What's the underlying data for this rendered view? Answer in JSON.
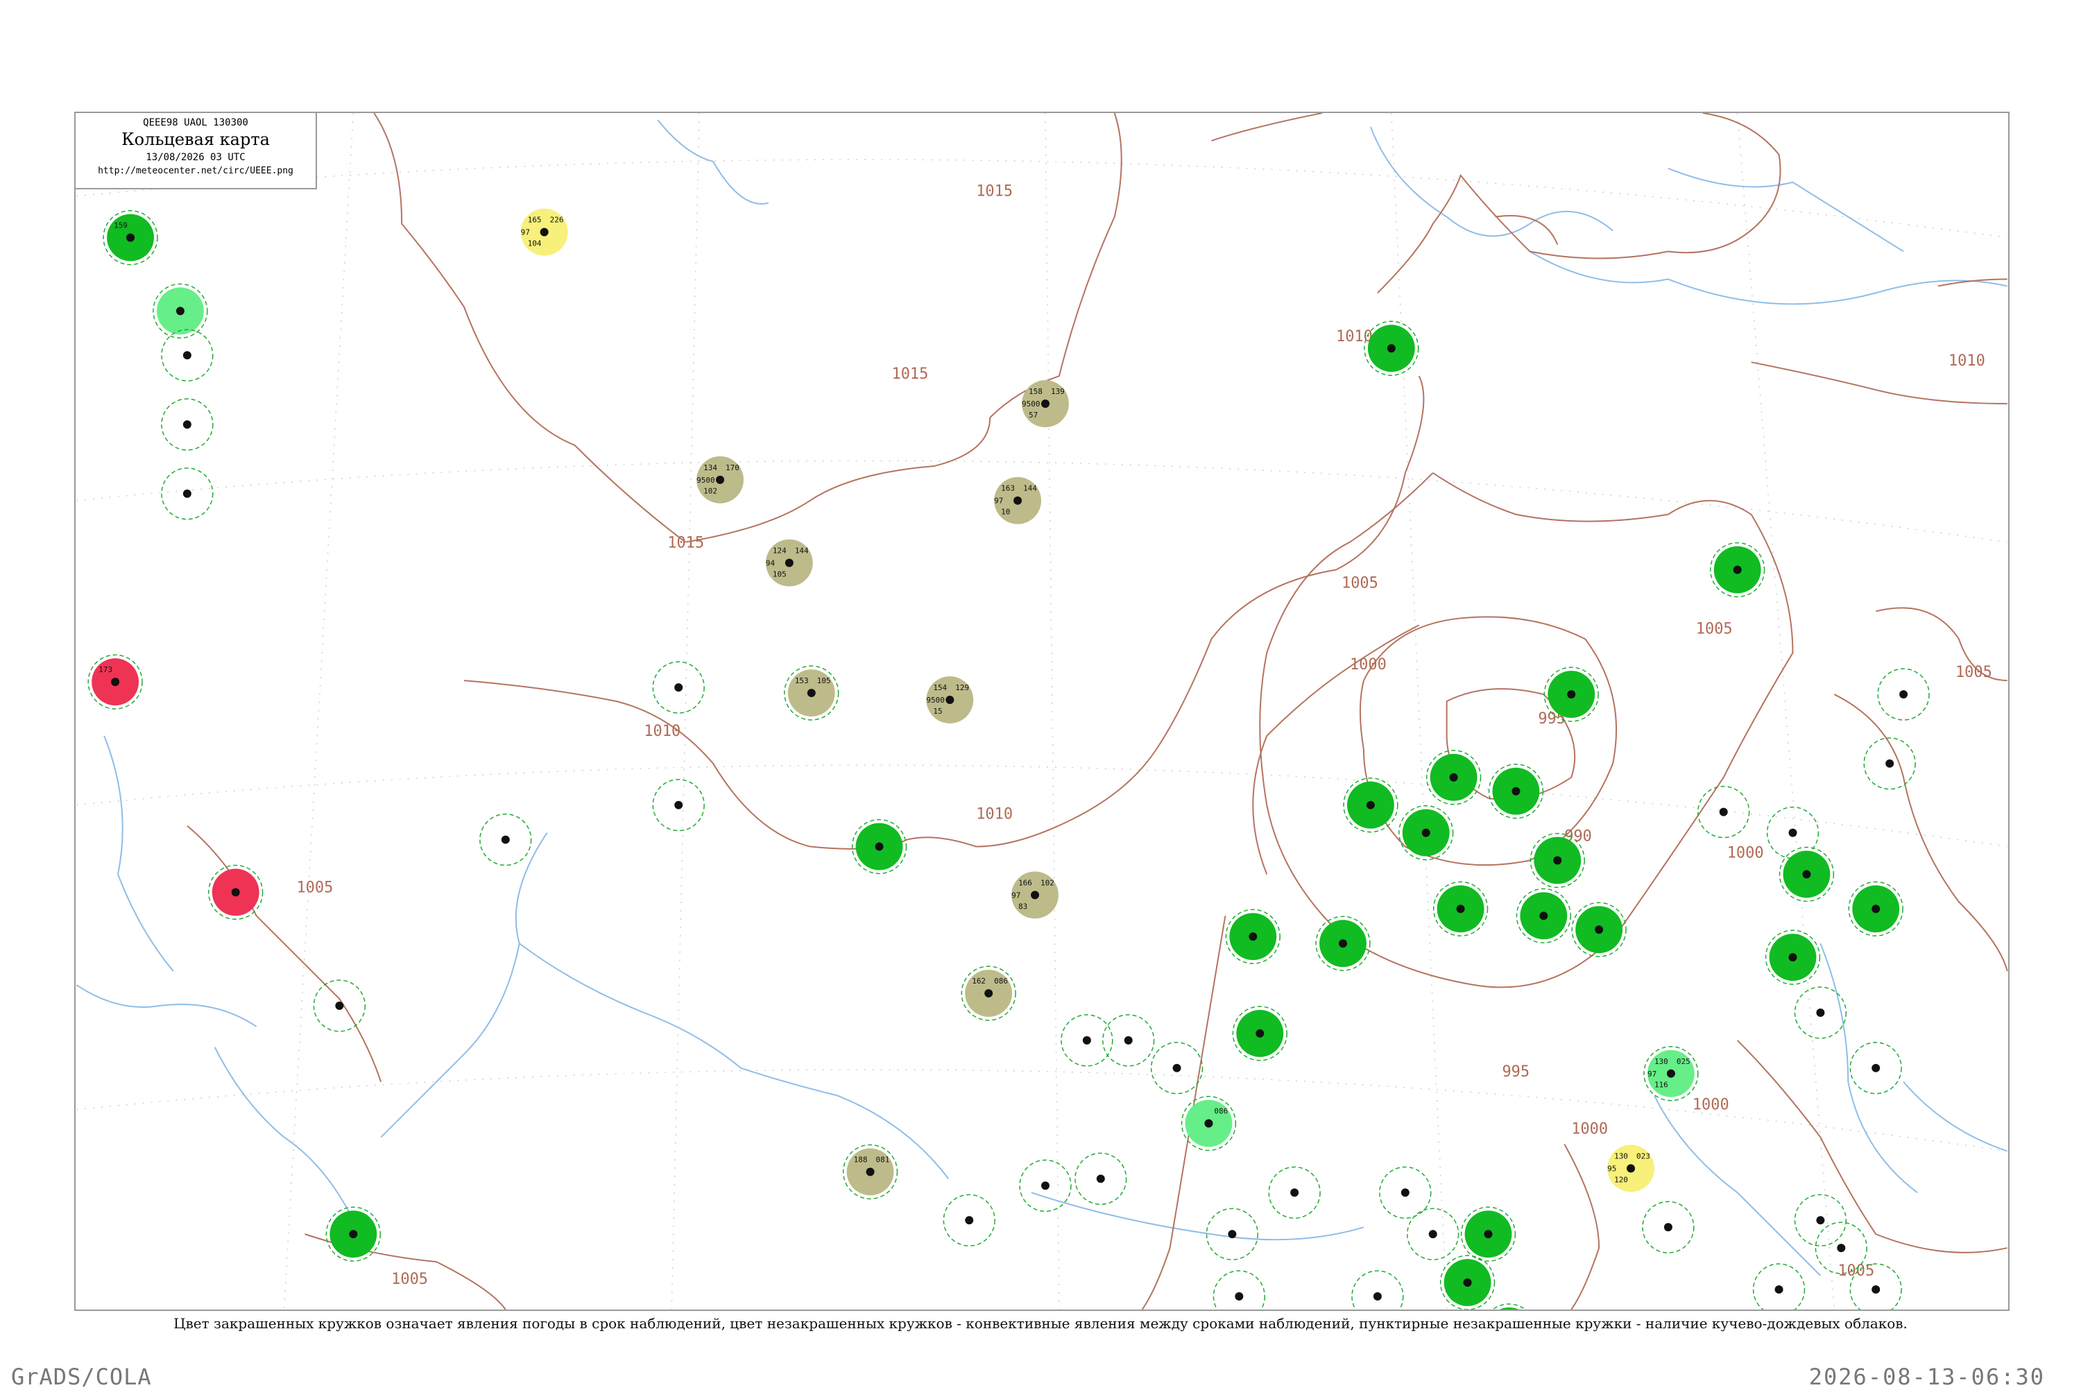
{
  "header": {
    "code": "QEEE98  UAOL  130300",
    "title": "Кольцевая карта",
    "date": "13/08/2026 03 UTC",
    "url": "http://meteocenter.net/circ/UEEE.png"
  },
  "legend_text": "Цвет закрашенных кружков означает явления погоды в срок наблюдений, цвет незакрашенных кружков - конвективные явления между сроками наблюдений, пунктирные незакрашенные кружки - наличие кучево-дождевых облаков.",
  "footer": {
    "left": "GrADS/COLA",
    "right": "2026-08-13-06:30"
  },
  "colors": {
    "isobar": "#b5735f",
    "river": "#8fbde8",
    "rain": "#11bb22",
    "shower_light": "#66ee88",
    "thunder": "#ee3355",
    "fog": "#bdbb8a",
    "haze": "#f7f07a",
    "cb_dash": "#22aa33"
  },
  "isobar_labels": [
    "1015",
    "1015",
    "1015",
    "1010",
    "1010",
    "1010",
    "1010",
    "1005",
    "1005",
    "1005",
    "1005",
    "1005",
    "1005",
    "1000",
    "1000",
    "1000",
    "1000",
    "995",
    "995",
    "990"
  ],
  "stations": [
    {
      "fill": "rain",
      "dashed": true,
      "top": "159",
      "left": "",
      "mid": "",
      "bot": "",
      "name": ""
    },
    {
      "fill": "shower_light",
      "dashed": true,
      "top": "",
      "left": "",
      "mid": "",
      "bot": "",
      "name": ""
    },
    {
      "fill": "thunder",
      "dashed": true,
      "top": "173",
      "left": "",
      "mid": "",
      "bot": "",
      "name": ""
    },
    {
      "fill": "thunder",
      "dashed": true,
      "top": "",
      "left": "",
      "mid": "",
      "bot": "",
      "name": ""
    },
    {
      "fill": "haze",
      "dashed": false,
      "top": "165",
      "left": "97",
      "mid": "226",
      "bot": "104",
      "name": ""
    },
    {
      "fill": "fog",
      "dashed": false,
      "top": "134",
      "left": "9500",
      "mid": "170",
      "bot": "102",
      "name": ""
    },
    {
      "fill": "fog",
      "dashed": false,
      "top": "124",
      "left": "94",
      "mid": "144",
      "bot": "105",
      "name": ""
    },
    {
      "fill": "fog",
      "dashed": false,
      "top": "158",
      "left": "9500",
      "mid": "139",
      "bot": "57",
      "name": ""
    },
    {
      "fill": "fog",
      "dashed": false,
      "top": "163",
      "left": "97",
      "mid": "144",
      "bot": "10",
      "name": ""
    },
    {
      "fill": "fog",
      "dashed": true,
      "top": "153",
      "left": "",
      "mid": "105",
      "bot": "",
      "name": ""
    },
    {
      "fill": "fog",
      "dashed": false,
      "top": "154",
      "left": "9500",
      "mid": "129",
      "bot": "15",
      "name": ""
    },
    {
      "fill": "fog",
      "dashed": false,
      "top": "166",
      "left": "97",
      "mid": "102",
      "bot": "83",
      "name": ""
    },
    {
      "fill": "fog",
      "dashed": true,
      "top": "162",
      "left": "",
      "mid": "086",
      "bot": "",
      "name": ""
    },
    {
      "fill": "fog",
      "dashed": true,
      "top": "188",
      "left": "",
      "mid": "081",
      "bot": "",
      "name": ""
    },
    {
      "fill": "haze",
      "dashed": false,
      "top": "130",
      "left": "95",
      "mid": "023",
      "bot": "120",
      "name": ""
    },
    {
      "fill": "shower_light",
      "dashed": true,
      "top": "130",
      "left": "97",
      "mid": "025",
      "bot": "116",
      "name": ""
    },
    {
      "fill": "shower_light",
      "dashed": true,
      "top": "",
      "left": "",
      "mid": "086",
      "bot": "",
      "name": ""
    }
  ]
}
